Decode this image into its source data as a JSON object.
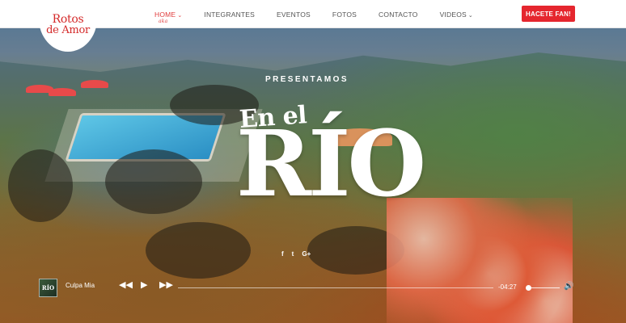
{
  "brand": {
    "logo_line1": "Rotos",
    "logo_line2": "de Amor",
    "accent_color": "#e5262e"
  },
  "nav": {
    "items": [
      {
        "label": "HOME",
        "active": true,
        "has_dropdown": true
      },
      {
        "label": "INTEGRANTES",
        "active": false,
        "has_dropdown": false
      },
      {
        "label": "EVENTOS",
        "active": false,
        "has_dropdown": false
      },
      {
        "label": "FOTOS",
        "active": false,
        "has_dropdown": false
      },
      {
        "label": "CONTACTO",
        "active": false,
        "has_dropdown": false
      },
      {
        "label": "VIDEOS",
        "active": false,
        "has_dropdown": true
      }
    ],
    "active_subtext": "aka",
    "cta_label": "HACETE FAN!"
  },
  "hero": {
    "kicker": "PRESENTAMOS",
    "title_small": "En el",
    "title_large": "RÍO",
    "social_icons": [
      "facebook-icon",
      "twitter-icon",
      "google-plus-icon"
    ],
    "social_glyphs": [
      "f",
      "t",
      "G+"
    ]
  },
  "player": {
    "album_label": "RÍO",
    "track_title": "Culpa Mia",
    "time_remaining": "-04:27",
    "progress_fraction": 0.0,
    "volume_fraction": 0.05
  }
}
